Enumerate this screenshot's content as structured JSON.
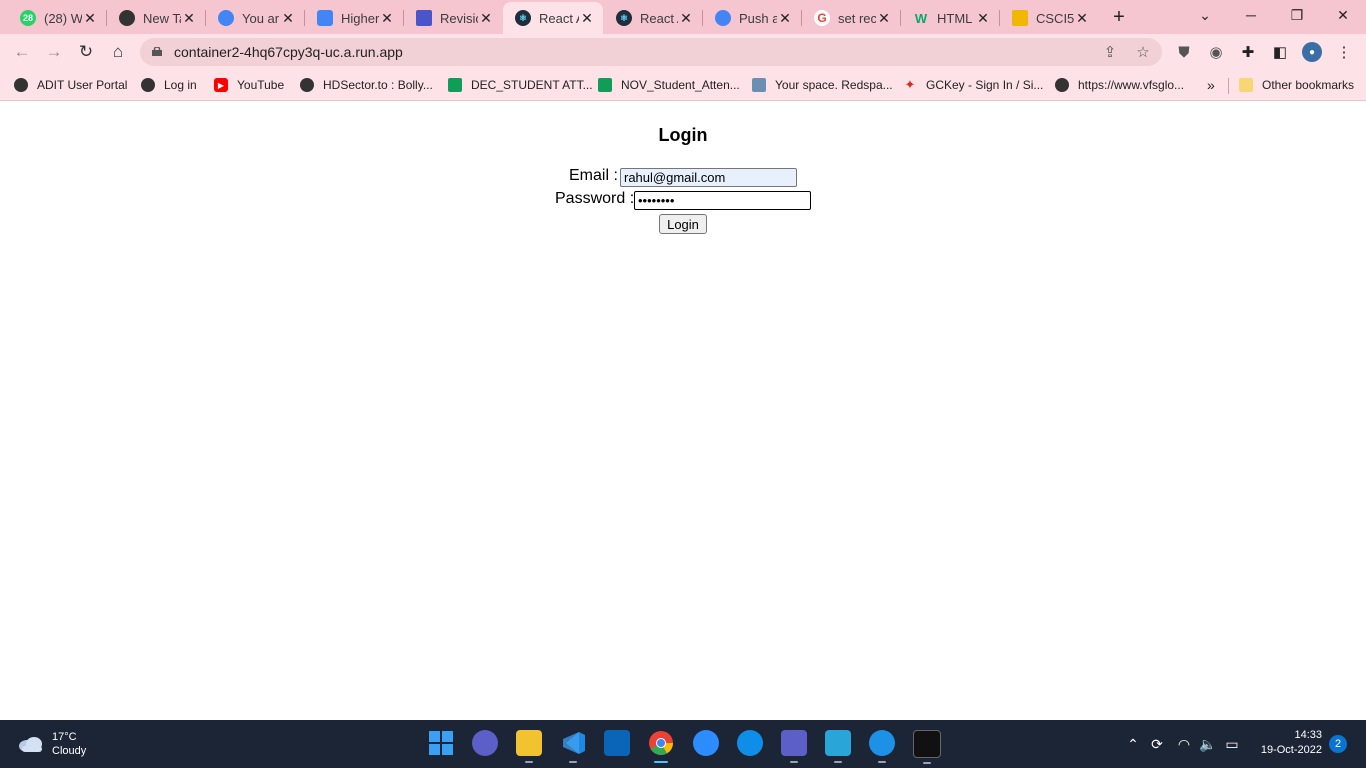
{
  "browser": {
    "tabs": [
      {
        "title": "(28) W",
        "favicon": "whatsapp-icon",
        "color": "#25d366",
        "badge": "28"
      },
      {
        "title": "New Ta",
        "favicon": "github-icon",
        "color": "#333333"
      },
      {
        "title": "You ar",
        "favicon": "google-cloud-icon",
        "color": "#4285f4"
      },
      {
        "title": "Higher",
        "favicon": "hexagon-icon",
        "color": "#4285f4"
      },
      {
        "title": "Revisio",
        "favicon": "arrow-icon",
        "color": "#4a55c9"
      },
      {
        "title": "React A",
        "favicon": "react-icon",
        "color": "#1f2d3d",
        "active": true
      },
      {
        "title": "React A",
        "favicon": "react-icon",
        "color": "#1f2d3d"
      },
      {
        "title": "Push a",
        "favicon": "google-cloud-icon",
        "color": "#4285f4"
      },
      {
        "title": "set rec",
        "favicon": "google-icon",
        "color": "#ea4335"
      },
      {
        "title": "HTML",
        "favicon": "w3schools-icon",
        "color": "#04aa6d"
      },
      {
        "title": "CSCI5",
        "favicon": "folder-icon",
        "color": "#f2b705"
      }
    ],
    "url": "container2-4hq67cpy3q-uc.a.run.app",
    "bookmarks": [
      {
        "label": "ADIT User Portal",
        "icon": "globe-icon",
        "color": "#333333"
      },
      {
        "label": "Log in",
        "icon": "globe-icon",
        "color": "#333333"
      },
      {
        "label": "YouTube",
        "icon": "youtube-icon",
        "color": "#ff0000"
      },
      {
        "label": "HDSector.to : Bolly...",
        "icon": "globe-icon",
        "color": "#333333"
      },
      {
        "label": "DEC_STUDENT ATT...",
        "icon": "sheets-icon",
        "color": "#0f9d58"
      },
      {
        "label": "NOV_Student_Atten...",
        "icon": "sheets-icon",
        "color": "#0f9d58"
      },
      {
        "label": "Your space. Redspa...",
        "icon": "redspace-icon",
        "color": "#6b8fb3"
      },
      {
        "label": "GCKey - Sign In / Si...",
        "icon": "maple-leaf-icon",
        "color": "#d52b1e"
      },
      {
        "label": "https://www.vfsglo...",
        "icon": "globe-icon",
        "color": "#333333"
      }
    ],
    "more_bookmarks": "»",
    "other_bookmarks": "Other bookmarks"
  },
  "page": {
    "title": "Login",
    "email_label": "Email :",
    "email_value": "rahul@gmail.com",
    "password_label": "Password :",
    "password_value": "••••••••",
    "login_button": "Login"
  },
  "taskbar": {
    "temperature": "17°C",
    "condition": "Cloudy",
    "time": "14:33",
    "date": "19-Oct-2022",
    "notifications": "2"
  }
}
